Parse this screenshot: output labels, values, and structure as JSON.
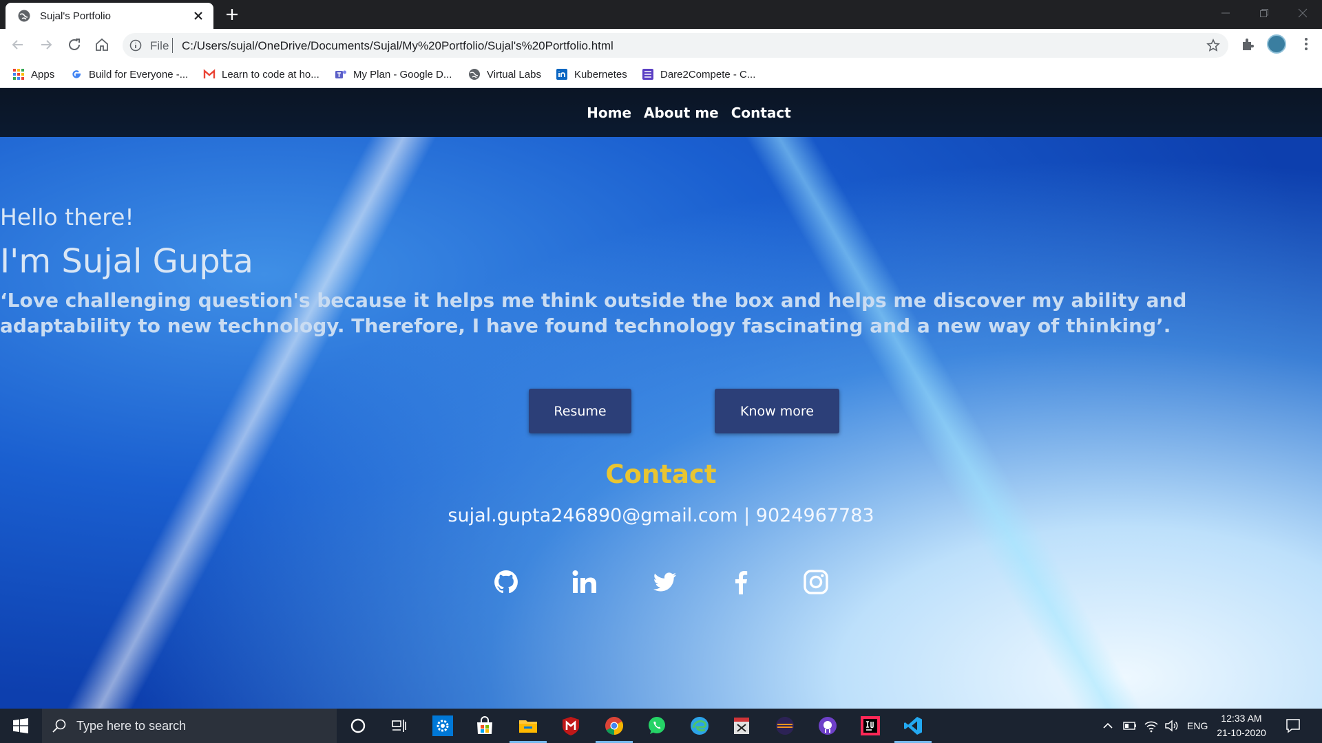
{
  "browser": {
    "tab_title": "Sujal's Portfolio",
    "address_scheme": "File",
    "address_url": "C:/Users/sujal/OneDrive/Documents/Sujal/My%20Portfolio/Sujal's%20Portfolio.html",
    "bookmarks": [
      {
        "label": "Apps",
        "icon": "apps-grid-icon"
      },
      {
        "label": "Build for Everyone -...",
        "icon": "google-icon"
      },
      {
        "label": "Learn to code at ho...",
        "icon": "gmail-icon"
      },
      {
        "label": "My Plan - Google D...",
        "icon": "teams-icon"
      },
      {
        "label": "Virtual Labs",
        "icon": "globe-icon"
      },
      {
        "label": "Kubernetes",
        "icon": "linkedin-icon"
      },
      {
        "label": "Dare2Compete - C...",
        "icon": "list-icon"
      }
    ]
  },
  "site": {
    "nav": [
      "Home",
      "About me",
      "Contact"
    ],
    "greeting": "Hello there!",
    "name": "I'm Sujal Gupta",
    "quote": "‘Love challenging question's because it helps me think outside the box and helps me discover my ability and adaptability to new technology. Therefore, I have found technology fascinating and a new way of thinking’.",
    "buttons": {
      "resume": "Resume",
      "know_more": "Know more"
    },
    "contact_title": "Contact",
    "contact_info": "sujal.gupta246890@gmail.com | 9024967783",
    "social_icons": [
      "github-icon",
      "linkedin-icon",
      "twitter-icon",
      "facebook-icon",
      "instagram-icon"
    ]
  },
  "taskbar": {
    "search_placeholder": "Type here to search",
    "language": "ENG",
    "time": "12:33 AM",
    "date": "21-10-2020"
  },
  "colors": {
    "nav_bg": "#0b1525",
    "button_bg": "#2c3f78",
    "contact_title": "#e9c531",
    "taskbar_bg": "#1b2330"
  }
}
